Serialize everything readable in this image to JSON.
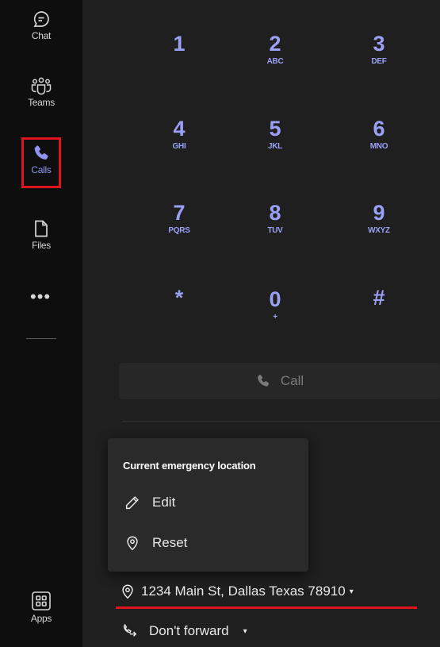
{
  "rail": {
    "items": [
      {
        "label": "Chat",
        "icon": "chat-icon"
      },
      {
        "label": "Teams",
        "icon": "teams-icon"
      },
      {
        "label": "Calls",
        "icon": "calls-icon",
        "active": true
      },
      {
        "label": "Files",
        "icon": "files-icon"
      },
      {
        "label": "Apps",
        "icon": "apps-icon"
      }
    ],
    "more": "•••"
  },
  "dialpad": {
    "keys": [
      {
        "digit": "1",
        "letters": ""
      },
      {
        "digit": "2",
        "letters": "ABC"
      },
      {
        "digit": "3",
        "letters": "DEF"
      },
      {
        "digit": "4",
        "letters": "GHI"
      },
      {
        "digit": "5",
        "letters": "JKL"
      },
      {
        "digit": "6",
        "letters": "MNO"
      },
      {
        "digit": "7",
        "letters": "PQRS"
      },
      {
        "digit": "8",
        "letters": "TUV"
      },
      {
        "digit": "9",
        "letters": "WXYZ"
      },
      {
        "digit": "*",
        "letters": ""
      },
      {
        "digit": "0",
        "letters": "+"
      },
      {
        "digit": "#",
        "letters": ""
      }
    ],
    "call_label": "Call"
  },
  "emergency_popup": {
    "title": "Current emergency location",
    "edit_label": "Edit",
    "reset_label": "Reset"
  },
  "location": {
    "text": "1234 Main St, Dallas Texas 78910",
    "caret": "▾"
  },
  "forwarding": {
    "text": "Don't forward",
    "caret": "▾"
  },
  "colors": {
    "accent": "#9aa0f5",
    "highlight": "#e0141e",
    "rail_bg": "#0e0e0e",
    "panel_bg": "#1f1f1f"
  }
}
